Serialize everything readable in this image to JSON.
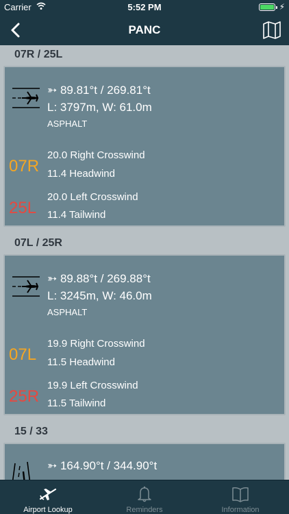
{
  "status": {
    "carrier": "Carrier",
    "time": "5:52 PM"
  },
  "nav": {
    "title": "PANC"
  },
  "runways": [
    {
      "header": "07R / 25L",
      "heading": "89.81°t / 269.81°t",
      "dims": "L: 3797m, W: 61.0m",
      "surface": "ASPHALT",
      "end_a": {
        "id": "07R",
        "cross": "20.0 Right Crosswind",
        "head": "11.4 Headwind"
      },
      "end_b": {
        "id": "25L",
        "cross": "20.0 Left Crosswind",
        "head": "11.4 Tailwind"
      }
    },
    {
      "header": "07L / 25R",
      "heading": "89.88°t / 269.88°t",
      "dims": "L: 3245m, W: 46.0m",
      "surface": "ASPHALT",
      "end_a": {
        "id": "07L",
        "cross": "19.9 Right Crosswind",
        "head": "11.5 Headwind"
      },
      "end_b": {
        "id": "25R",
        "cross": "19.9 Left Crosswind",
        "head": "11.5 Tailwind"
      }
    },
    {
      "header": "15 / 33",
      "heading": "164.90°t / 344.90°t"
    }
  ],
  "tabs": [
    {
      "label": "Airport Lookup",
      "icon": "airplane-icon"
    },
    {
      "label": "Reminders",
      "icon": "bell-icon"
    },
    {
      "label": "Information",
      "icon": "book-icon"
    }
  ],
  "colors": {
    "bar": "#1d3844",
    "card": "#6b8590",
    "end_a": "#f5a623",
    "end_b": "#e8483f"
  }
}
